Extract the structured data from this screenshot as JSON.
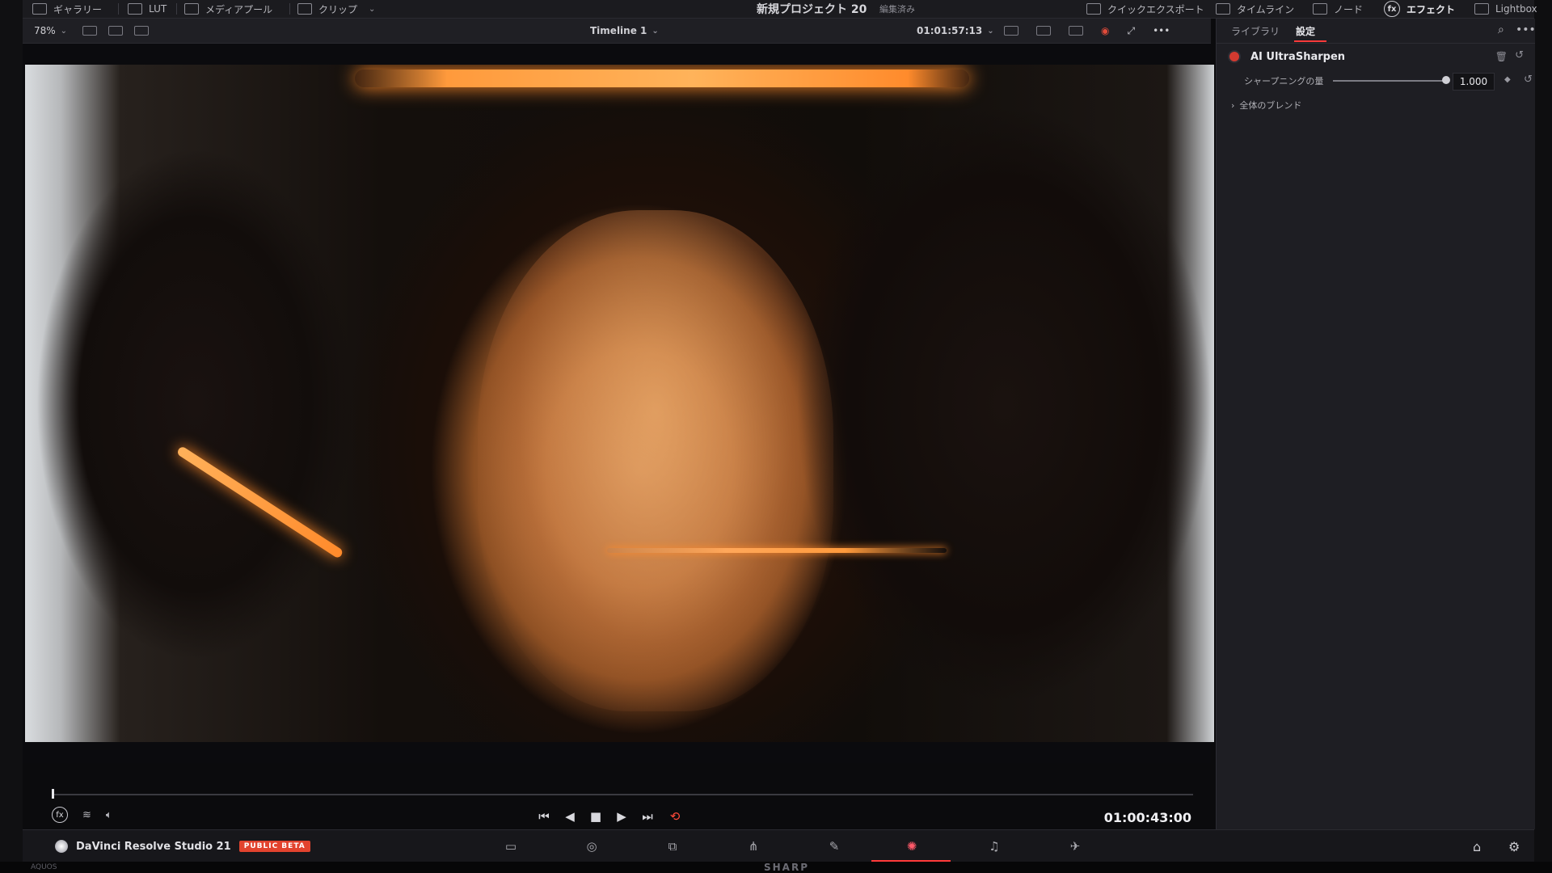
{
  "topbar": {
    "gallery_label": "ギャラリー",
    "lut_label": "LUT",
    "media_pool_label": "メディアプール",
    "clip_label": "クリップ",
    "project_title": "新規プロジェクト 20",
    "project_status": "編集済み",
    "quick_export_label": "クイックエクスポート",
    "timeline_label": "タイムライン",
    "node_label": "ノード",
    "effects_label": "エフェクト",
    "lightbox_label": "Lightbox"
  },
  "viewer_toolbar": {
    "zoom": "78%",
    "timeline_name": "Timeline 1",
    "timecode": "01:01:57:13"
  },
  "transport": {
    "timecode": "01:00:43:00"
  },
  "inspector": {
    "tab_library": "ライブラリ",
    "tab_settings": "設定",
    "effect_name": "AI UltraSharpen",
    "param_label": "シャープニングの量",
    "param_value": "1.000",
    "param_fraction": 1.0,
    "blend_label": "全体のブレンド"
  },
  "bottombar": {
    "app_name": "DaVinci Resolve Studio 21",
    "badge": "PUBLIC BETA"
  },
  "footer": {
    "brand": "SHARP",
    "left_text": "AQUOS"
  },
  "colors": {
    "accent_red": "#ff3a3a",
    "beta_badge": "#e2432e",
    "panel_bg": "#1e1e23"
  }
}
